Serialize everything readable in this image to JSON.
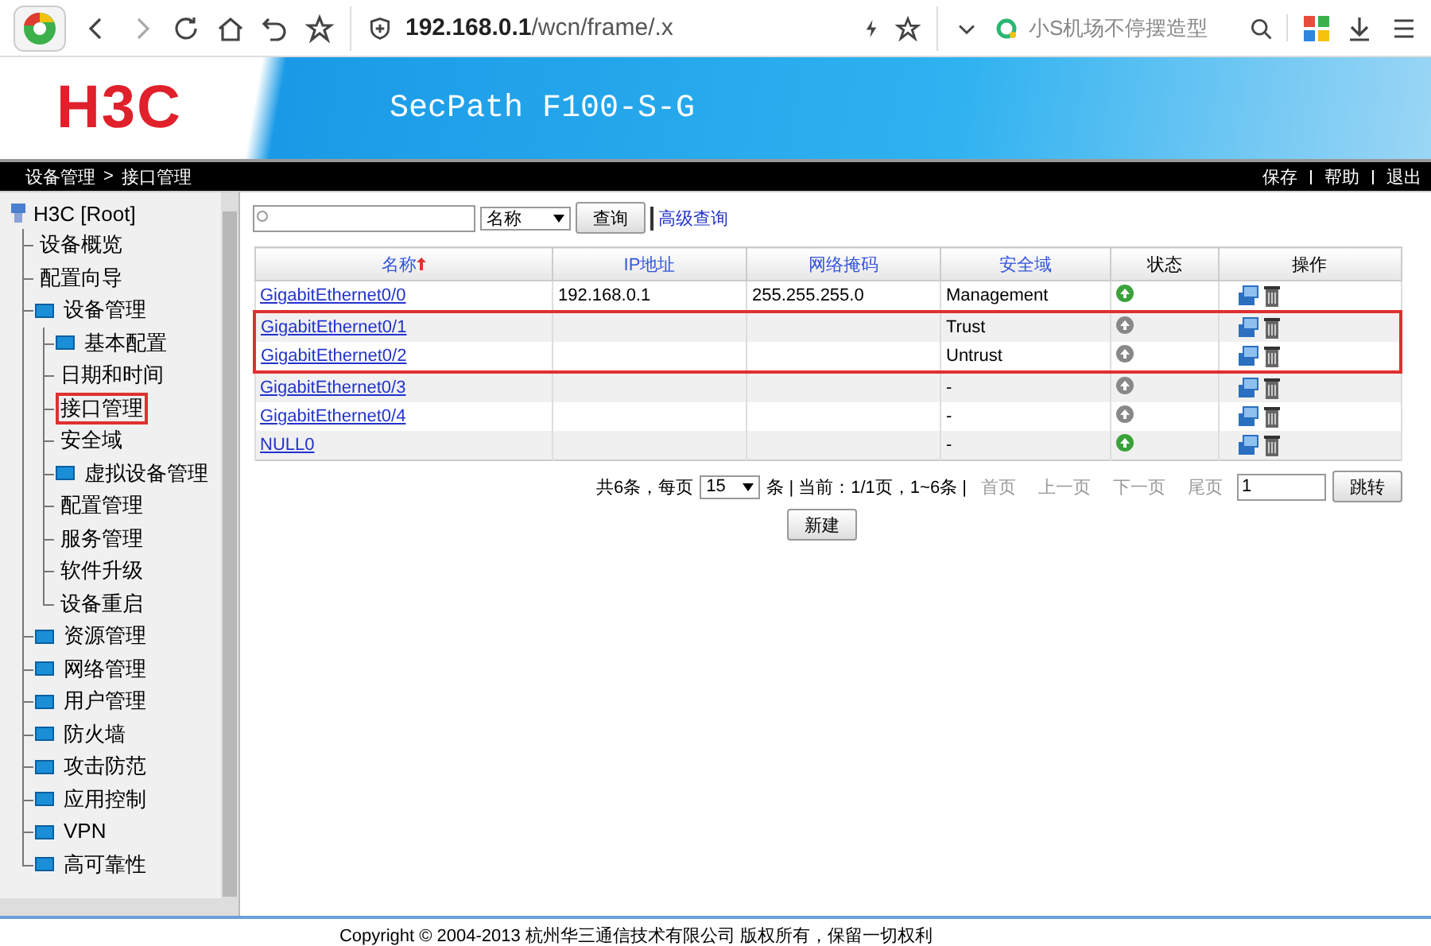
{
  "browser": {
    "url": "**192.168.0.1**/wcn/frame/.x",
    "search_placeholder": "小S机场不停摆造型"
  },
  "banner": {
    "logo": "H3C",
    "product": "SecPath F100-S-G"
  },
  "nav_bar": {
    "breadcrumb": [
      "设备管理",
      "接口管理"
    ],
    "separator": ">",
    "links": [
      "保存",
      "帮助",
      "退出"
    ]
  },
  "sidebar": {
    "root": "H3C [Root]",
    "items": [
      {
        "label": "设备概览",
        "kind": "page",
        "selected": false
      },
      {
        "label": "配置向导",
        "kind": "page",
        "selected": false
      },
      {
        "label": "设备管理",
        "kind": "folder",
        "selected": false,
        "expanded": true,
        "children": [
          {
            "label": "基本配置",
            "kind": "folder",
            "selected": false
          },
          {
            "label": "日期和时间",
            "kind": "page",
            "selected": false
          },
          {
            "label": "接口管理",
            "kind": "page",
            "selected": true
          },
          {
            "label": "安全域",
            "kind": "page",
            "selected": false
          },
          {
            "label": "虚拟设备管理",
            "kind": "folder",
            "selected": false
          },
          {
            "label": "配置管理",
            "kind": "page",
            "selected": false
          },
          {
            "label": "服务管理",
            "kind": "page",
            "selected": false
          },
          {
            "label": "软件升级",
            "kind": "page",
            "selected": false
          },
          {
            "label": "设备重启",
            "kind": "page",
            "selected": false
          }
        ]
      },
      {
        "label": "资源管理",
        "kind": "folder",
        "selected": false
      },
      {
        "label": "网络管理",
        "kind": "folder",
        "selected": false
      },
      {
        "label": "用户管理",
        "kind": "folder",
        "selected": false
      },
      {
        "label": "防火墙",
        "kind": "folder",
        "selected": false
      },
      {
        "label": "攻击防范",
        "kind": "folder",
        "selected": false
      },
      {
        "label": "应用控制",
        "kind": "folder",
        "selected": false
      },
      {
        "label": "VPN",
        "kind": "folder",
        "selected": false
      },
      {
        "label": "高可靠性",
        "kind": "folder",
        "selected": false
      }
    ]
  },
  "search": {
    "field_option": "名称",
    "button": "查询",
    "advanced": "高级查询"
  },
  "table": {
    "columns": [
      "名称",
      "IP地址",
      "网络掩码",
      "安全域",
      "状态",
      "操作"
    ],
    "rows": [
      {
        "name": "GigabitEthernet0/0",
        "ip": "192.168.0.1",
        "mask": "255.255.255.0",
        "zone": "Management",
        "online": true,
        "highlighted": false
      },
      {
        "name": "GigabitEthernet0/1",
        "ip": "",
        "mask": "",
        "zone": "Trust",
        "online": false,
        "highlighted": true
      },
      {
        "name": "GigabitEthernet0/2",
        "ip": "",
        "mask": "",
        "zone": "Untrust",
        "online": false,
        "highlighted": true
      },
      {
        "name": "GigabitEthernet0/3",
        "ip": "",
        "mask": "",
        "zone": "-",
        "online": false,
        "highlighted": false
      },
      {
        "name": "GigabitEthernet0/4",
        "ip": "",
        "mask": "",
        "zone": "-",
        "online": false,
        "highlighted": false
      },
      {
        "name": "NULL0",
        "ip": "",
        "mask": "",
        "zone": "-",
        "online": true,
        "highlighted": false
      }
    ]
  },
  "pager": {
    "total": "共6条，每页",
    "page_size": "15",
    "info": "条 | 当前：1/1页，1~6条 |",
    "links": [
      "首页",
      "上一页",
      "下一页",
      "尾页"
    ],
    "jump_value": "1",
    "jump_button": "跳转"
  },
  "new_button": "新建",
  "footer": "Copyright © 2004-2013 杭州华三通信技术有限公司 版权所有，保留一切权利"
}
